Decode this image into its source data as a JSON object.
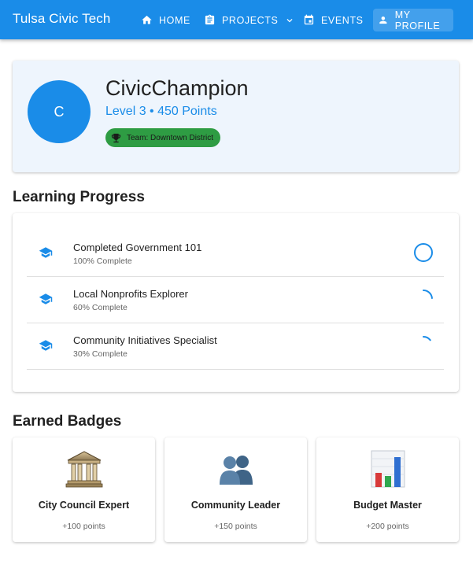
{
  "app": {
    "title": "Tulsa Civic Tech"
  },
  "nav": {
    "items": [
      {
        "label": "HOME",
        "icon": "home-icon"
      },
      {
        "label": "PROJECTS",
        "icon": "clipboard-icon",
        "has_dropdown": true
      },
      {
        "label": "EVENTS",
        "icon": "calendar-icon"
      },
      {
        "label": "MY PROFILE",
        "icon": "person-icon",
        "active": true
      }
    ]
  },
  "profile": {
    "avatar_initial": "C",
    "username": "CivicChampion",
    "level_points": "Level 3 • 450 Points",
    "team": "Team: Downtown District",
    "team_icon": "trophy-icon"
  },
  "learning": {
    "title": "Learning Progress",
    "items": [
      {
        "name": "Completed Government 101",
        "progress_text": "100% Complete",
        "progress": 100
      },
      {
        "name": "Local Nonprofits Explorer",
        "progress_text": "60% Complete",
        "progress": 60
      },
      {
        "name": "Community Initiatives Specialist",
        "progress_text": "30% Complete",
        "progress": 30
      }
    ]
  },
  "badges": {
    "title": "Earned Badges",
    "items": [
      {
        "name": "City Council Expert",
        "points": "+100 points",
        "icon": "classical-building-icon"
      },
      {
        "name": "Community Leader",
        "points": "+150 points",
        "icon": "people-icon"
      },
      {
        "name": "Budget Master",
        "points": "+200 points",
        "icon": "bar-chart-icon"
      }
    ]
  },
  "colors": {
    "primary": "#1a8ce8",
    "team_chip": "#2e9c43",
    "profile_bg": "#eef5fd"
  }
}
